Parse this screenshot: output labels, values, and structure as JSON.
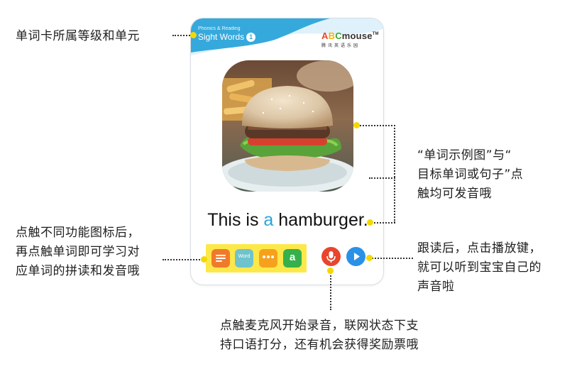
{
  "card": {
    "level": {
      "series": "Phonics & Reading",
      "name": "Sight Words",
      "number": "1"
    },
    "brand": {
      "logo_parts": [
        "A",
        "B",
        "C",
        "mouse"
      ],
      "tm": "TM",
      "sub": "腾讯英语乐园"
    },
    "sentence": {
      "before": "This is ",
      "highlight": "a",
      "after": " hamburger."
    },
    "function_buttons": [
      {
        "icon": "sentence-card-icon",
        "color": "#f07a2c"
      },
      {
        "icon": "word-icon",
        "color": "#6fc3cc",
        "label": "Word"
      },
      {
        "icon": "chat-icon",
        "color": "#f6a11e"
      },
      {
        "icon": "letter-a-icon",
        "color": "#35b04a",
        "label": "a"
      }
    ],
    "mic": {
      "icon": "microphone-icon",
      "color": "#e8452c"
    },
    "play": {
      "icon": "play-icon",
      "color": "#2a91e8"
    }
  },
  "callouts": {
    "level": "单词卡所属等级和单元",
    "example": [
      "“单词示例图”与“",
      "目标单词或句子”点",
      "触均可发音哦"
    ],
    "function": [
      "点触不同功能图标后，",
      "再点触单词即可学习对",
      "应单词的拼读和发音哦"
    ],
    "play": [
      "跟读后，点击播放键，",
      "就可以听到宝宝自己的",
      "声音啦"
    ],
    "mic": [
      "点触麦克风开始录音，联网状态下支",
      "持口语打分，还有机会获得奖励票哦"
    ]
  },
  "colors": {
    "header_blue": "#35a9dc",
    "highlight_blue": "#2aa3dc",
    "marker_yellow": "#f5d800",
    "function_bar_yellow": "#fde84a"
  }
}
